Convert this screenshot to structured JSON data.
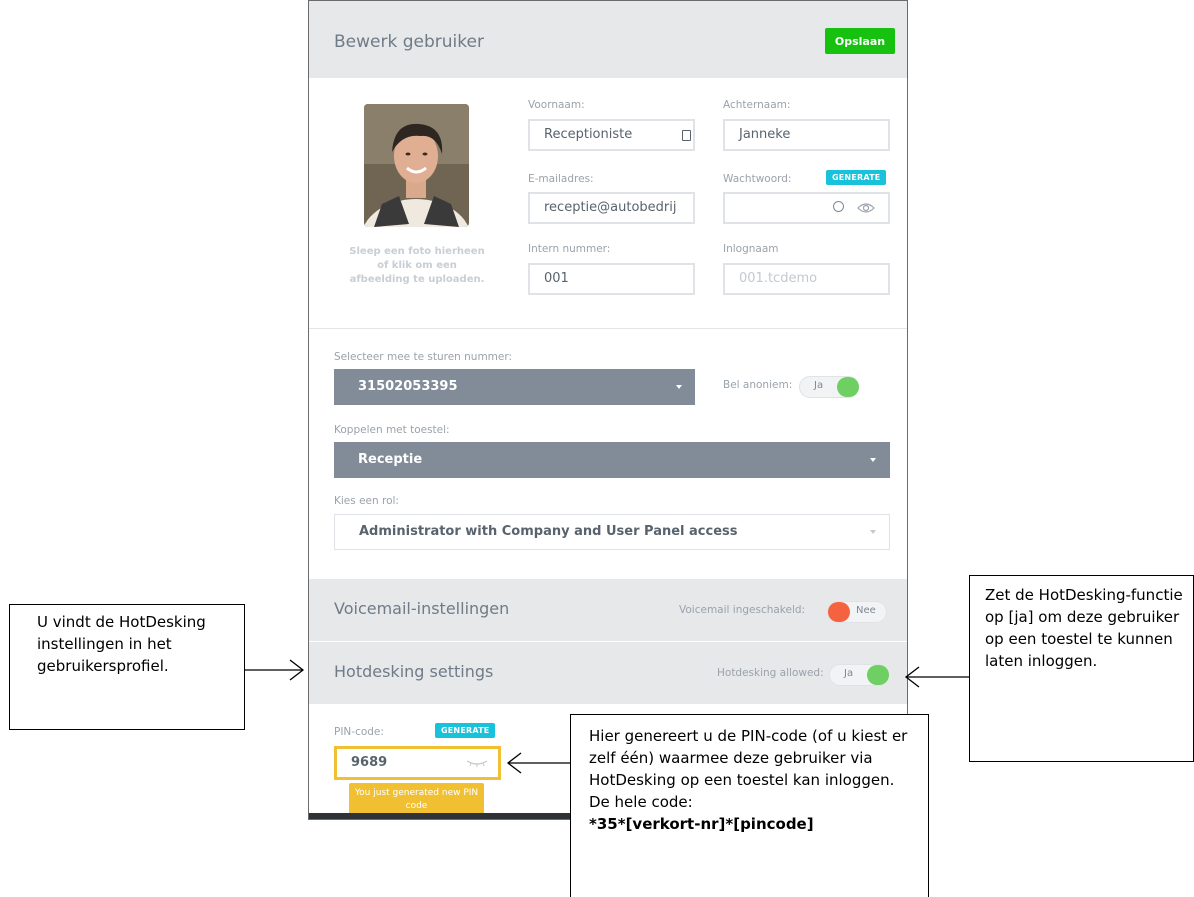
{
  "header": {
    "title": "Bewerk gebruiker",
    "save_label": "Opslaan"
  },
  "photo": {
    "hint": "Sleep een foto hierheen of klik om een afbeelding te uploaden."
  },
  "fields": {
    "firstname": {
      "label": "Voornaam:",
      "value": "Receptioniste"
    },
    "lastname": {
      "label": "Achternaam:",
      "value": "Janneke"
    },
    "email": {
      "label": "E-mailadres:",
      "value": "receptie@autobedrij"
    },
    "password": {
      "label": "Wachtwoord:",
      "value": "",
      "generate_label": "GENERATE"
    },
    "internal_number": {
      "label": "Intern nummer:",
      "value": "001"
    },
    "login_name": {
      "label": "Inlognaam",
      "placeholder": "001.tcdemo"
    }
  },
  "caller_id": {
    "label": "Selecteer mee te sturen nummer:",
    "value": "31502053395"
  },
  "anonymous": {
    "label": "Bel anoniem:",
    "value": "Ja"
  },
  "device": {
    "label": "Koppelen met toestel:",
    "value": "Receptie"
  },
  "role": {
    "label": "Kies een rol:",
    "value": "Administrator with Company and User Panel access"
  },
  "voicemail": {
    "title": "Voicemail-instellingen",
    "toggle_label": "Voicemail ingeschakeld:",
    "value": "Nee"
  },
  "hotdesking": {
    "title": "Hotdesking settings",
    "toggle_label": "Hotdesking allowed:",
    "value": "Ja"
  },
  "pin": {
    "label": "PIN-code:",
    "generate_label": "GENERATE",
    "value": "9689",
    "tooltip": "You just generated new PIN code"
  },
  "annotations": {
    "left": "U vindt de HotDesking instellingen in het gebruikersprofiel.",
    "right": "Zet de HotDesking-functie op [ja] om deze gebruiker op een toestel te kunnen laten inloggen.",
    "bottom": "Hier genereert u de PIN-code (of u kiest er zelf één) waarmee deze gebruiker via HotDesking op een toestel kan inloggen. De hele code:",
    "bottom_code": "*35*[verkort-nr]*[pincode]"
  },
  "colors": {
    "save_green": "#16c20f",
    "generate_cyan": "#18c2da",
    "toggle_on": "#6ecf62",
    "toggle_off": "#f4623f",
    "pin_highlight": "#f0c032"
  }
}
